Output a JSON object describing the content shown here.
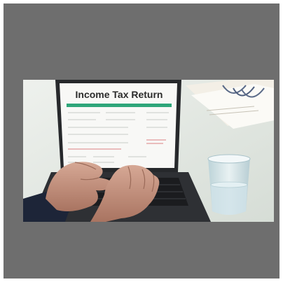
{
  "frame": {
    "background": "#6e6e6e"
  },
  "photo": {
    "screen_title": "Income Tax Return",
    "colors": {
      "table": "#dfe4df",
      "laptop": "#2b2d30",
      "screen": "#f8f8f6",
      "header_bar": "#2ea67a",
      "skin": "#c99a86",
      "sleeve": "#1d2538",
      "glass": "#cfe1e6"
    }
  }
}
